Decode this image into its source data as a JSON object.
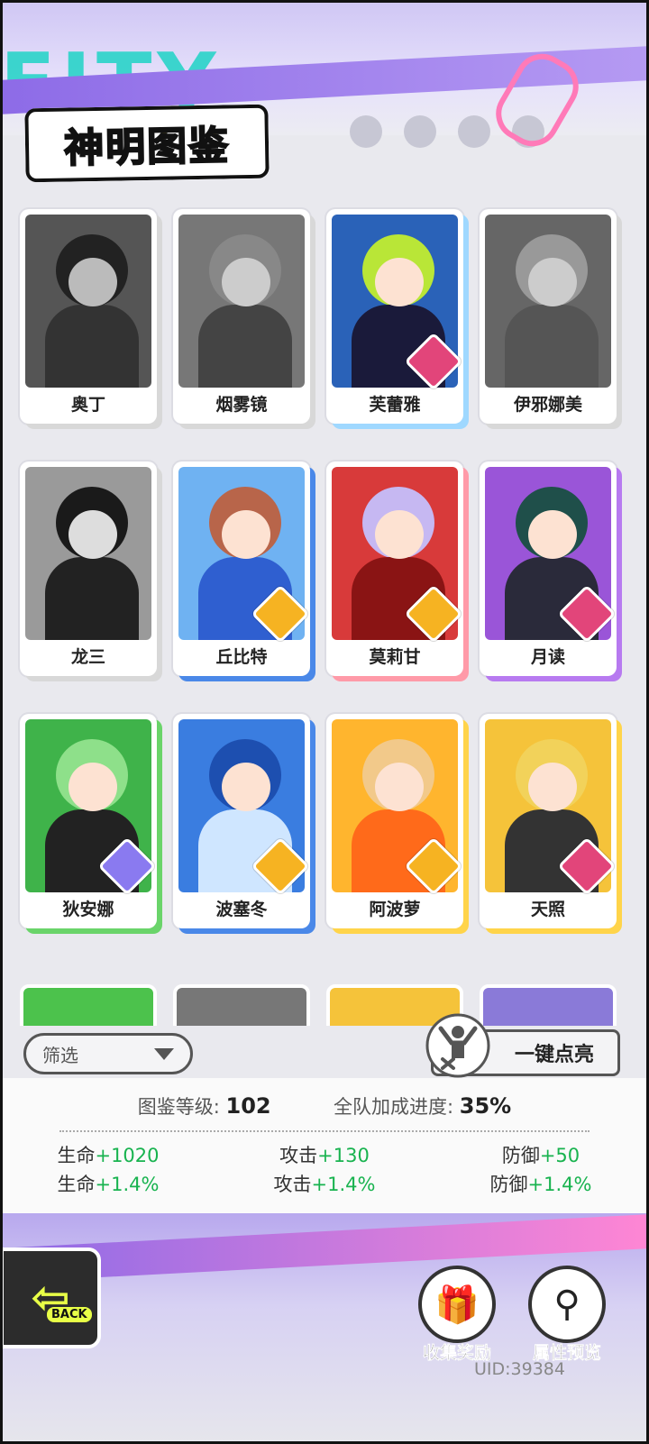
{
  "header": {
    "title": "神明图鉴"
  },
  "cards": [
    {
      "name": "奥丁",
      "unlocked": false
    },
    {
      "name": "烟雾镜",
      "unlocked": false
    },
    {
      "name": "芙蕾雅",
      "unlocked": true
    },
    {
      "name": "伊邪娜美",
      "unlocked": false
    },
    {
      "name": "龙三",
      "unlocked": false
    },
    {
      "name": "丘比特",
      "unlocked": true
    },
    {
      "name": "莫莉甘",
      "unlocked": true
    },
    {
      "name": "月读",
      "unlocked": true
    },
    {
      "name": "狄安娜",
      "unlocked": true
    },
    {
      "name": "波塞冬",
      "unlocked": true
    },
    {
      "name": "阿波萝",
      "unlocked": true
    },
    {
      "name": "天照",
      "unlocked": true
    }
  ],
  "filter": {
    "label": "筛选"
  },
  "light_up_button": {
    "label": "一键点亮"
  },
  "stats": {
    "level_label": "图鉴等级:",
    "level_value": "102",
    "progress_label": "全队加成进度:",
    "progress_value": "35%",
    "bonuses": [
      [
        {
          "label": "生命",
          "value": "+1020"
        },
        {
          "label": "攻击",
          "value": "+130"
        },
        {
          "label": "防御",
          "value": "+50"
        }
      ],
      [
        {
          "label": "生命",
          "value": "+1.4%"
        },
        {
          "label": "攻击",
          "value": "+1.4%"
        },
        {
          "label": "防御",
          "value": "+1.4%"
        }
      ]
    ]
  },
  "back_button": {
    "label": "BACK"
  },
  "collect_reward": {
    "label": "收集奖励",
    "icon": "gift-icon"
  },
  "attribute_preview": {
    "label": "属性预览",
    "icon": "magnifier-icon"
  },
  "uid": "UID:39384",
  "colors": {
    "accent_purple": "#8d6be7",
    "bonus_green": "#18b34f"
  }
}
